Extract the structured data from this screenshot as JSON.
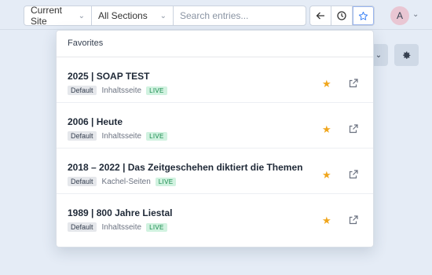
{
  "toolbar": {
    "site_select": "Current Site",
    "sections_select": "All Sections",
    "search_placeholder": "Search entries...",
    "avatar_initial": "A"
  },
  "favorites": {
    "heading": "Favorites",
    "entries": [
      {
        "title": "2025 | SOAP TEST",
        "type": "Default",
        "section": "Inhaltsseite",
        "status": "LIVE"
      },
      {
        "title": "2006 | Heute",
        "type": "Default",
        "section": "Inhaltsseite",
        "status": "LIVE"
      },
      {
        "title": "2018 – 2022 | Das Zeitgeschehen diktiert die Themen",
        "type": "Default",
        "section": "Kachel-Seiten",
        "status": "LIVE"
      },
      {
        "title": "1989 | 800 Jahre Liestal",
        "type": "Default",
        "section": "Inhaltsseite",
        "status": "LIVE"
      }
    ]
  },
  "colors": {
    "background": "#e5ecf6",
    "favorite_star": "#f0a61c",
    "live_badge": "#d1f2e0"
  }
}
